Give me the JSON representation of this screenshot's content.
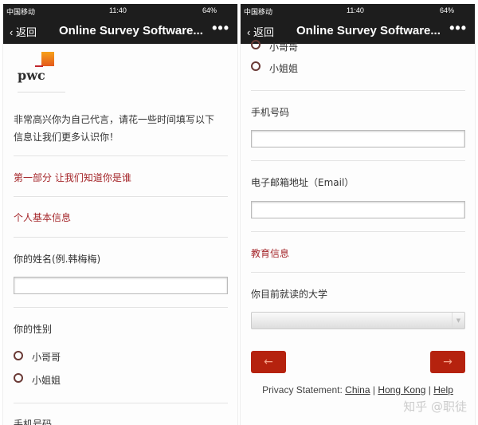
{
  "status": {
    "carrier": "中国移动",
    "time": "11:40",
    "battery": "64%"
  },
  "nav": {
    "back": "返回",
    "title": "Online Survey Software...",
    "more": "•••"
  },
  "logo": "pwc",
  "intro": [
    "非常高兴你为自己代言，请花一些时间填写以下",
    "信息让我们更多认识你！"
  ],
  "section1": "第一部分 让我们知道你是谁",
  "basic_info": "个人基本信息",
  "name_label": "你的姓名(例.韩梅梅)",
  "gender_label": "你的性别",
  "gender_options": [
    "小哥哥",
    "小姐姐"
  ],
  "phone_label": "手机号码",
  "email_label": "电子邮箱地址（Email）",
  "education": "教育信息",
  "university_label": "你目前就读的大学",
  "buttons": {
    "prev": "←",
    "next": "→"
  },
  "privacy": {
    "label": "Privacy Statement:",
    "china": "China",
    "hk": "Hong Kong",
    "help": "Help",
    "sep": "|"
  },
  "watermark": "知乎 @职徒"
}
